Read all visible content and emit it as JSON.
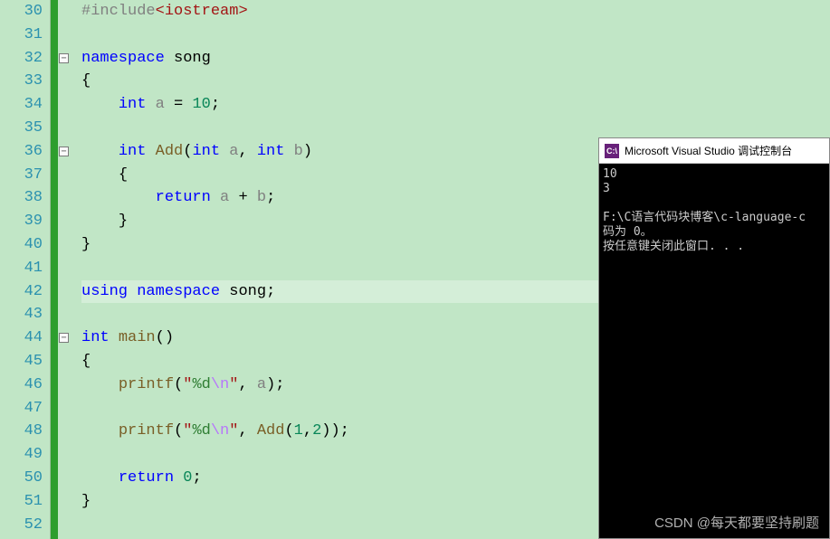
{
  "lines": {
    "start": 30,
    "end": 52
  },
  "code": {
    "l30_preproc": "#include",
    "l30_header": "<iostream>",
    "l32_ns": "namespace",
    "l32_name": "song",
    "l33_brace": "{",
    "l34_int": "int",
    "l34_a": "a",
    "l34_eq": " = ",
    "l34_val": "10",
    "l34_semi": ";",
    "l36_int": "int",
    "l36_fn": "Add",
    "l36_open": "(",
    "l36_int1": "int",
    "l36_p1": "a",
    "l36_comma": ",",
    "l36_int2": "int",
    "l36_p2": "b",
    "l36_close": ")",
    "l37_brace": "{",
    "l38_ret": "return",
    "l38_a": "a",
    "l38_plus": " + ",
    "l38_b": "b",
    "l38_semi": ";",
    "l39_brace": "}",
    "l40_brace": "}",
    "l42_using": "using",
    "l42_ns": "namespace",
    "l42_name": "song",
    "l42_semi": ";",
    "l44_int": "int",
    "l44_main": "main",
    "l44_paren": "()",
    "l45_brace": "{",
    "l46_fn": "printf",
    "l46_open": "(",
    "l46_q1": "\"",
    "l46_fmt": "%d",
    "l46_esc": "\\n",
    "l46_q2": "\"",
    "l46_comma": ", ",
    "l46_arg": "a",
    "l46_close": ");",
    "l48_fn": "printf",
    "l48_open": "(",
    "l48_q1": "\"",
    "l48_fmt": "%d",
    "l48_esc": "\\n",
    "l48_q2": "\"",
    "l48_comma": ", ",
    "l48_call": "Add",
    "l48_callopen": "(",
    "l48_n1": "1",
    "l48_c": ",",
    "l48_n2": "2",
    "l48_callclose": "));",
    "l50_ret": "return",
    "l50_val": "0",
    "l50_semi": ";",
    "l51_brace": "}"
  },
  "console": {
    "title": "Microsoft Visual Studio 调试控制台",
    "line1": "10",
    "line2": "3",
    "line3": "",
    "line4": "F:\\C语言代码块博客\\c-language-c",
    "line5": "码为 0。",
    "line6": "按任意键关闭此窗口. . ."
  },
  "watermark": "CSDN @每天都要坚持刷题"
}
